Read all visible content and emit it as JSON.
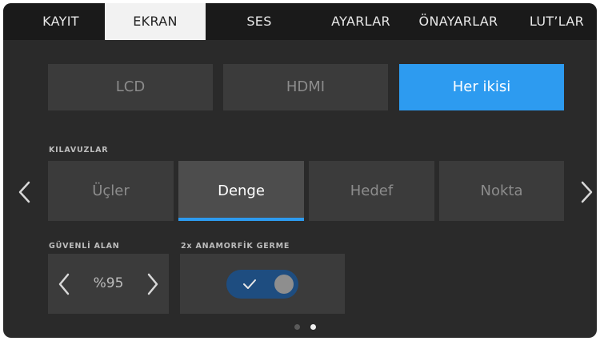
{
  "tabs": [
    {
      "label": "KAYIT"
    },
    {
      "label": "EKRAN"
    },
    {
      "label": "SES"
    },
    {
      "label": "AYARLAR"
    },
    {
      "label": "ÖNAYARLAR"
    },
    {
      "label": "LUT’LAR"
    }
  ],
  "active_tab": "EKRAN",
  "output_buttons": [
    {
      "label": "LCD"
    },
    {
      "label": "HDMI"
    },
    {
      "label": "Her ikisi"
    }
  ],
  "selected_output": "Her ikisi",
  "guides": {
    "label": "KILAVUZLAR",
    "options": [
      {
        "label": "Üçler"
      },
      {
        "label": "Denge"
      },
      {
        "label": "Hedef"
      },
      {
        "label": "Nokta"
      }
    ],
    "selected": "Denge"
  },
  "safe_area": {
    "label": "GÜVENLİ ALAN",
    "value": "%95"
  },
  "anamorphic": {
    "label": "2x ANAMORFİK GERME",
    "enabled": true
  },
  "pagination": {
    "pages": 2,
    "current": 2
  },
  "colors": {
    "accent": "#2d9bf0",
    "toggle_on": "#1e4d80",
    "background": "#2a2a2a",
    "tile": "#3b3b3b"
  },
  "icons": [
    "chevron-left-icon",
    "chevron-right-icon",
    "checkmark-icon"
  ]
}
